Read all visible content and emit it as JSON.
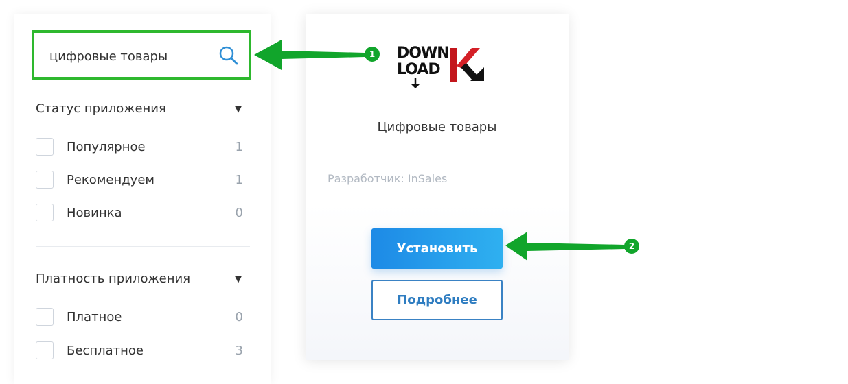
{
  "search": {
    "value": "цифровые товары"
  },
  "filters": {
    "status": {
      "title": "Статус приложения",
      "items": [
        {
          "label": "Популярное",
          "count": "1"
        },
        {
          "label": "Рекомендуем",
          "count": "1"
        },
        {
          "label": "Новинка",
          "count": "0"
        }
      ]
    },
    "pricing": {
      "title": "Платность приложения",
      "items": [
        {
          "label": "Платное",
          "count": "0"
        },
        {
          "label": "Бесплатное",
          "count": "3"
        }
      ]
    }
  },
  "card": {
    "logo_text_line1": "DOWN",
    "logo_text_line2": "LOAD",
    "title": "Цифровые товары",
    "developer": "Разработчик: InSales",
    "install_label": "Установить",
    "more_label": "Подробнее"
  },
  "annotations": {
    "badge1": "1",
    "badge2": "2",
    "color": "#11a52b"
  },
  "colors": {
    "highlight_border": "#2eb82e",
    "primary": "#1d8ae6",
    "outline_button": "#3a82c4"
  }
}
